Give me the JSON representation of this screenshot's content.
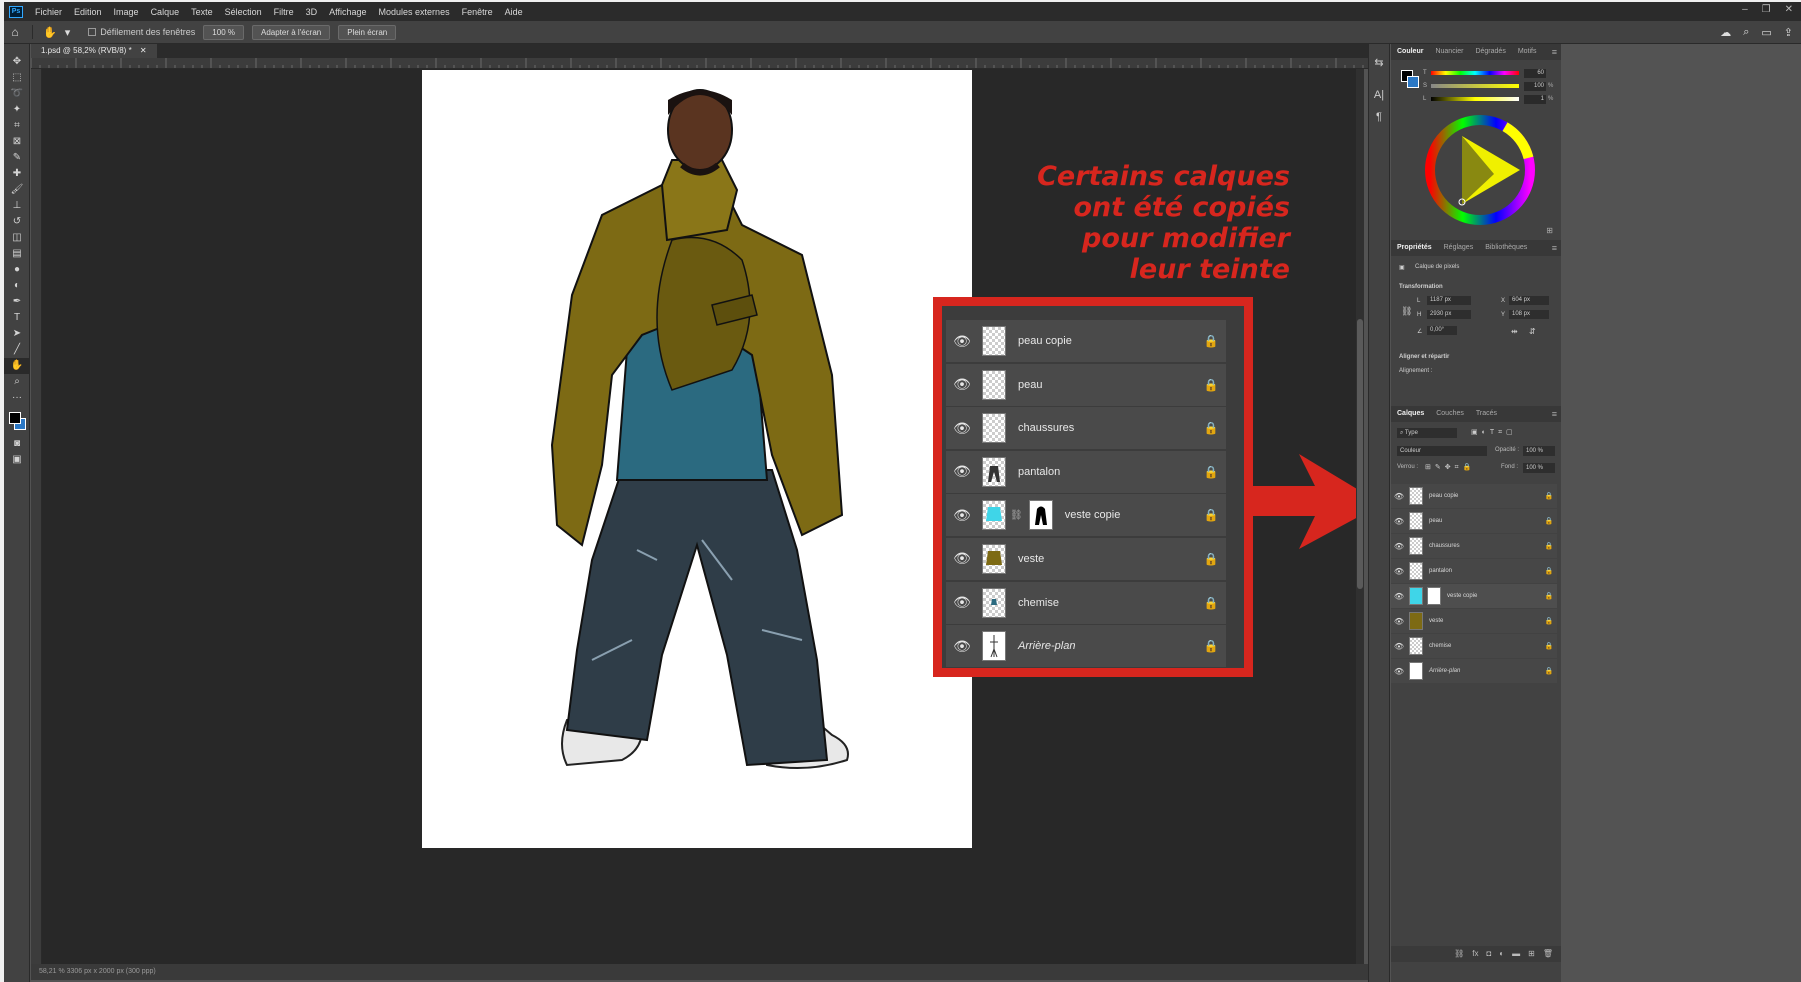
{
  "app": {
    "logo": "Ps"
  },
  "menu": [
    "Fichier",
    "Edition",
    "Image",
    "Calque",
    "Texte",
    "Sélection",
    "Filtre",
    "3D",
    "Affichage",
    "Modules externes",
    "Fenêtre",
    "Aide"
  ],
  "options": {
    "all_windows": "Défilement des fenêtres",
    "zoom_btn": "100 %",
    "fit_btn": "Adapter à l'écran",
    "fill_btn": "Plein écran"
  },
  "document": {
    "tab": "1.psd @ 58,2% (RVB/8) *",
    "status": "58,21 %     3306 px x 2000 px (300 ppp)"
  },
  "annotation": {
    "lines": [
      "Certains calques",
      "ont été copiés",
      "pour modifier",
      "leur teinte"
    ],
    "color": "#d7261e"
  },
  "layers": [
    {
      "name": "peau copie",
      "italic": false,
      "mask": false
    },
    {
      "name": "peau",
      "italic": false,
      "mask": false
    },
    {
      "name": "chaussures",
      "italic": false,
      "mask": false
    },
    {
      "name": "pantalon",
      "italic": false,
      "mask": false
    },
    {
      "name": "veste copie",
      "italic": false,
      "mask": true
    },
    {
      "name": "veste",
      "italic": false,
      "mask": false
    },
    {
      "name": "chemise",
      "italic": false,
      "mask": false
    },
    {
      "name": "Arrière-plan",
      "italic": true,
      "mask": false
    }
  ],
  "color_panel": {
    "tabs": [
      "Couleur",
      "Nuancier",
      "Dégradés",
      "Motifs"
    ],
    "t_label": "T",
    "s_label": "S",
    "l_label": "L",
    "t_value": "60",
    "s_value": "100",
    "l_value": "1",
    "pct": "%"
  },
  "properties": {
    "tabs": [
      "Propriétés",
      "Réglages",
      "Bibliothèques"
    ],
    "kind": "Calque de pixels",
    "section_transform": "Transformation",
    "w_label": "L",
    "w_value": "1187 px",
    "h_label": "H",
    "h_value": "2930 px",
    "x_label": "X",
    "x_value": "604 px",
    "y_label": "Y",
    "y_value": "108 px",
    "angle": "0,00°",
    "section_align": "Aligner et répartir",
    "align_label": "Alignement :"
  },
  "layers_panel": {
    "tabs": [
      "Calques",
      "Couches",
      "Tracés"
    ],
    "filter": "Type",
    "blend": "Couleur",
    "opacity_label": "Opacité :",
    "opacity": "100 %",
    "lock_label": "Verrou :",
    "fill_label": "Fond :",
    "fill": "100 %"
  }
}
